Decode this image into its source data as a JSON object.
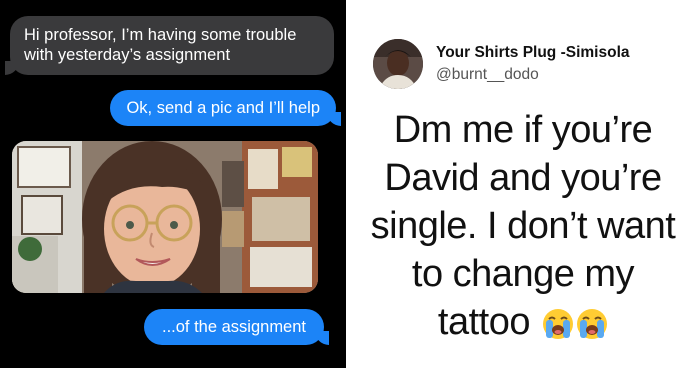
{
  "messages": {
    "received_1": "Hi professor, I’m having some trouble with yesterday’s assignment",
    "sent_1": "Ok, send a pic and I’ll help",
    "sent_2": "...of the assignment"
  },
  "tweet": {
    "display_name": "Your Shirts Plug -Simisola",
    "handle": "@burnt__dodo",
    "lines": [
      "Dm me if you’re",
      "David and you’re",
      "single. I don’t want",
      "to change my",
      "tattoo"
    ],
    "emoji": [
      "loudly-crying-face-icon",
      "loudly-crying-face-icon"
    ]
  },
  "colors": {
    "received_bubble": "#3a3a3c",
    "sent_bubble": "#1c84f7",
    "chat_background": "#000000"
  }
}
